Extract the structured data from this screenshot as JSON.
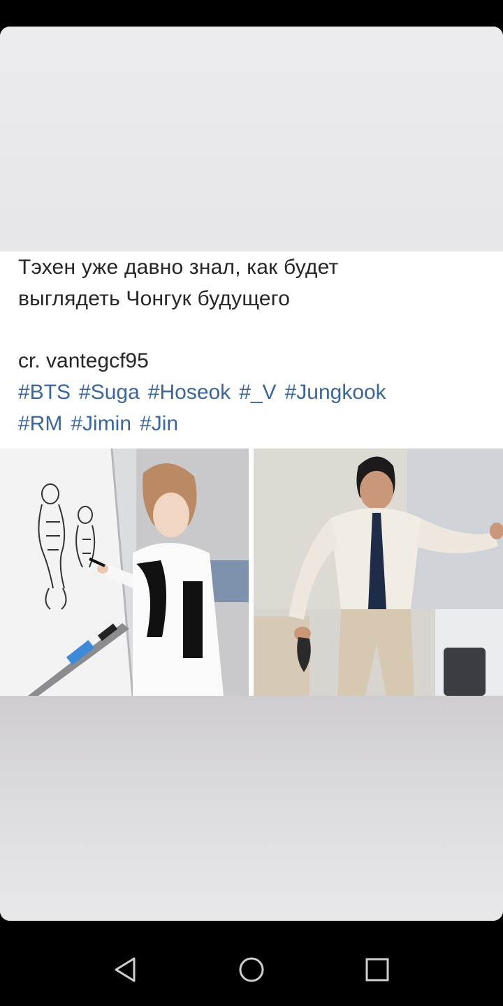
{
  "post": {
    "caption_line1": "Тэхен уже давно знал, как будет",
    "caption_line2": "выглядеть Чонгук будущего",
    "credit": "cr. vantegcf95",
    "hashtags_line1": [
      "#BTS",
      "#Suga",
      "#Hoseok",
      "#_V",
      "#Jungkook"
    ],
    "hashtags_line2": [
      "#RM",
      "#Jimin",
      "#Jin"
    ],
    "hashtag_color": "#3b6699"
  },
  "photos": [
    {
      "name": "photo-whiteboard-drawing"
    },
    {
      "name": "photo-posing-in-shirt-and-tie"
    }
  ],
  "nav": {
    "back_icon": "back-triangle-icon",
    "home_icon": "home-circle-icon",
    "recents_icon": "recents-square-icon"
  }
}
